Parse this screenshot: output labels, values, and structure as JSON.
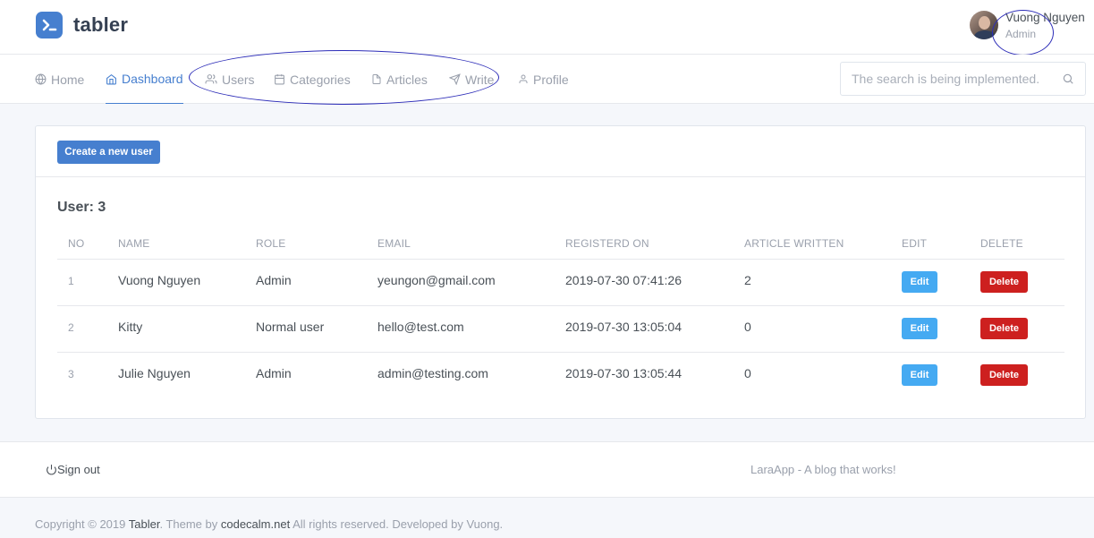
{
  "brand": {
    "name": "tabler"
  },
  "user": {
    "name": "Vuong Nguyen",
    "role": "Admin"
  },
  "nav": {
    "items": [
      {
        "label": "Home",
        "icon": "globe-icon"
      },
      {
        "label": "Dashboard",
        "icon": "home-icon"
      },
      {
        "label": "Users",
        "icon": "users-icon"
      },
      {
        "label": "Categories",
        "icon": "calendar-icon"
      },
      {
        "label": "Articles",
        "icon": "file-icon"
      },
      {
        "label": "Write",
        "icon": "send-icon"
      },
      {
        "label": "Profile",
        "icon": "user-icon"
      }
    ],
    "active": "Dashboard"
  },
  "search": {
    "placeholder": "The search is being implemented."
  },
  "card": {
    "create_button": "Create a new user",
    "user_count": "User: 3"
  },
  "table": {
    "headers": [
      "NO",
      "NAME",
      "ROLE",
      "EMAIL",
      "REGISTERD ON",
      "ARTICLE WRITTEN",
      "EDIT",
      "DELETE"
    ],
    "rows": [
      {
        "no": "1",
        "name": "Vuong Nguyen",
        "role": "Admin",
        "email": "yeungon@gmail.com",
        "registered": "2019-07-30 07:41:26",
        "articles": "2",
        "edit": "Edit",
        "delete": "Delete"
      },
      {
        "no": "2",
        "name": "Kitty",
        "role": "Normal user",
        "email": "hello@test.com",
        "registered": "2019-07-30 13:05:04",
        "articles": "0",
        "edit": "Edit",
        "delete": "Delete"
      },
      {
        "no": "3",
        "name": "Julie Nguyen",
        "role": "Admin",
        "email": "admin@testing.com",
        "registered": "2019-07-30 13:05:44",
        "articles": "0",
        "edit": "Edit",
        "delete": "Delete"
      }
    ]
  },
  "footer": {
    "sign_out": "Sign out",
    "tagline": "LaraApp - A blog that works!",
    "copyright_pre": "Copyright © 2019 ",
    "copyright_link1": "Tabler",
    "copyright_mid": ". Theme by ",
    "copyright_link2": "codecalm.net",
    "copyright_post": " All rights reserved. Developed by Vuong."
  },
  "colors": {
    "primary": "#467fcf",
    "edit": "#45aaf2",
    "delete": "#cd201f",
    "annotation": "#2d2db8"
  }
}
